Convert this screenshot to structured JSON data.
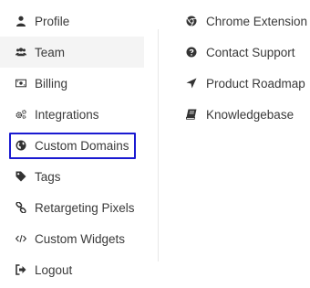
{
  "menu": {
    "left_items": [
      {
        "label": "Profile",
        "icon": "user-icon"
      },
      {
        "label": "Team",
        "icon": "users-icon"
      },
      {
        "label": "Billing",
        "icon": "money-bill-icon"
      },
      {
        "label": "Integrations",
        "icon": "cogs-icon"
      },
      {
        "label": "Custom Domains",
        "icon": "globe-icon"
      },
      {
        "label": "Tags",
        "icon": "tag-icon"
      },
      {
        "label": "Retargeting Pixels",
        "icon": "link-icon"
      },
      {
        "label": "Custom Widgets",
        "icon": "code-icon"
      },
      {
        "label": "Logout",
        "icon": "sign-out-icon"
      }
    ],
    "right_items": [
      {
        "label": "Chrome Extension",
        "icon": "chrome-icon"
      },
      {
        "label": "Contact Support",
        "icon": "question-circle-icon"
      },
      {
        "label": "Product Roadmap",
        "icon": "location-arrow-icon"
      },
      {
        "label": "Knowledgebase",
        "icon": "book-icon"
      }
    ],
    "hovered_item": "Team",
    "highlighted_item": "Custom Domains",
    "highlight_color": "#1a1ad1"
  }
}
